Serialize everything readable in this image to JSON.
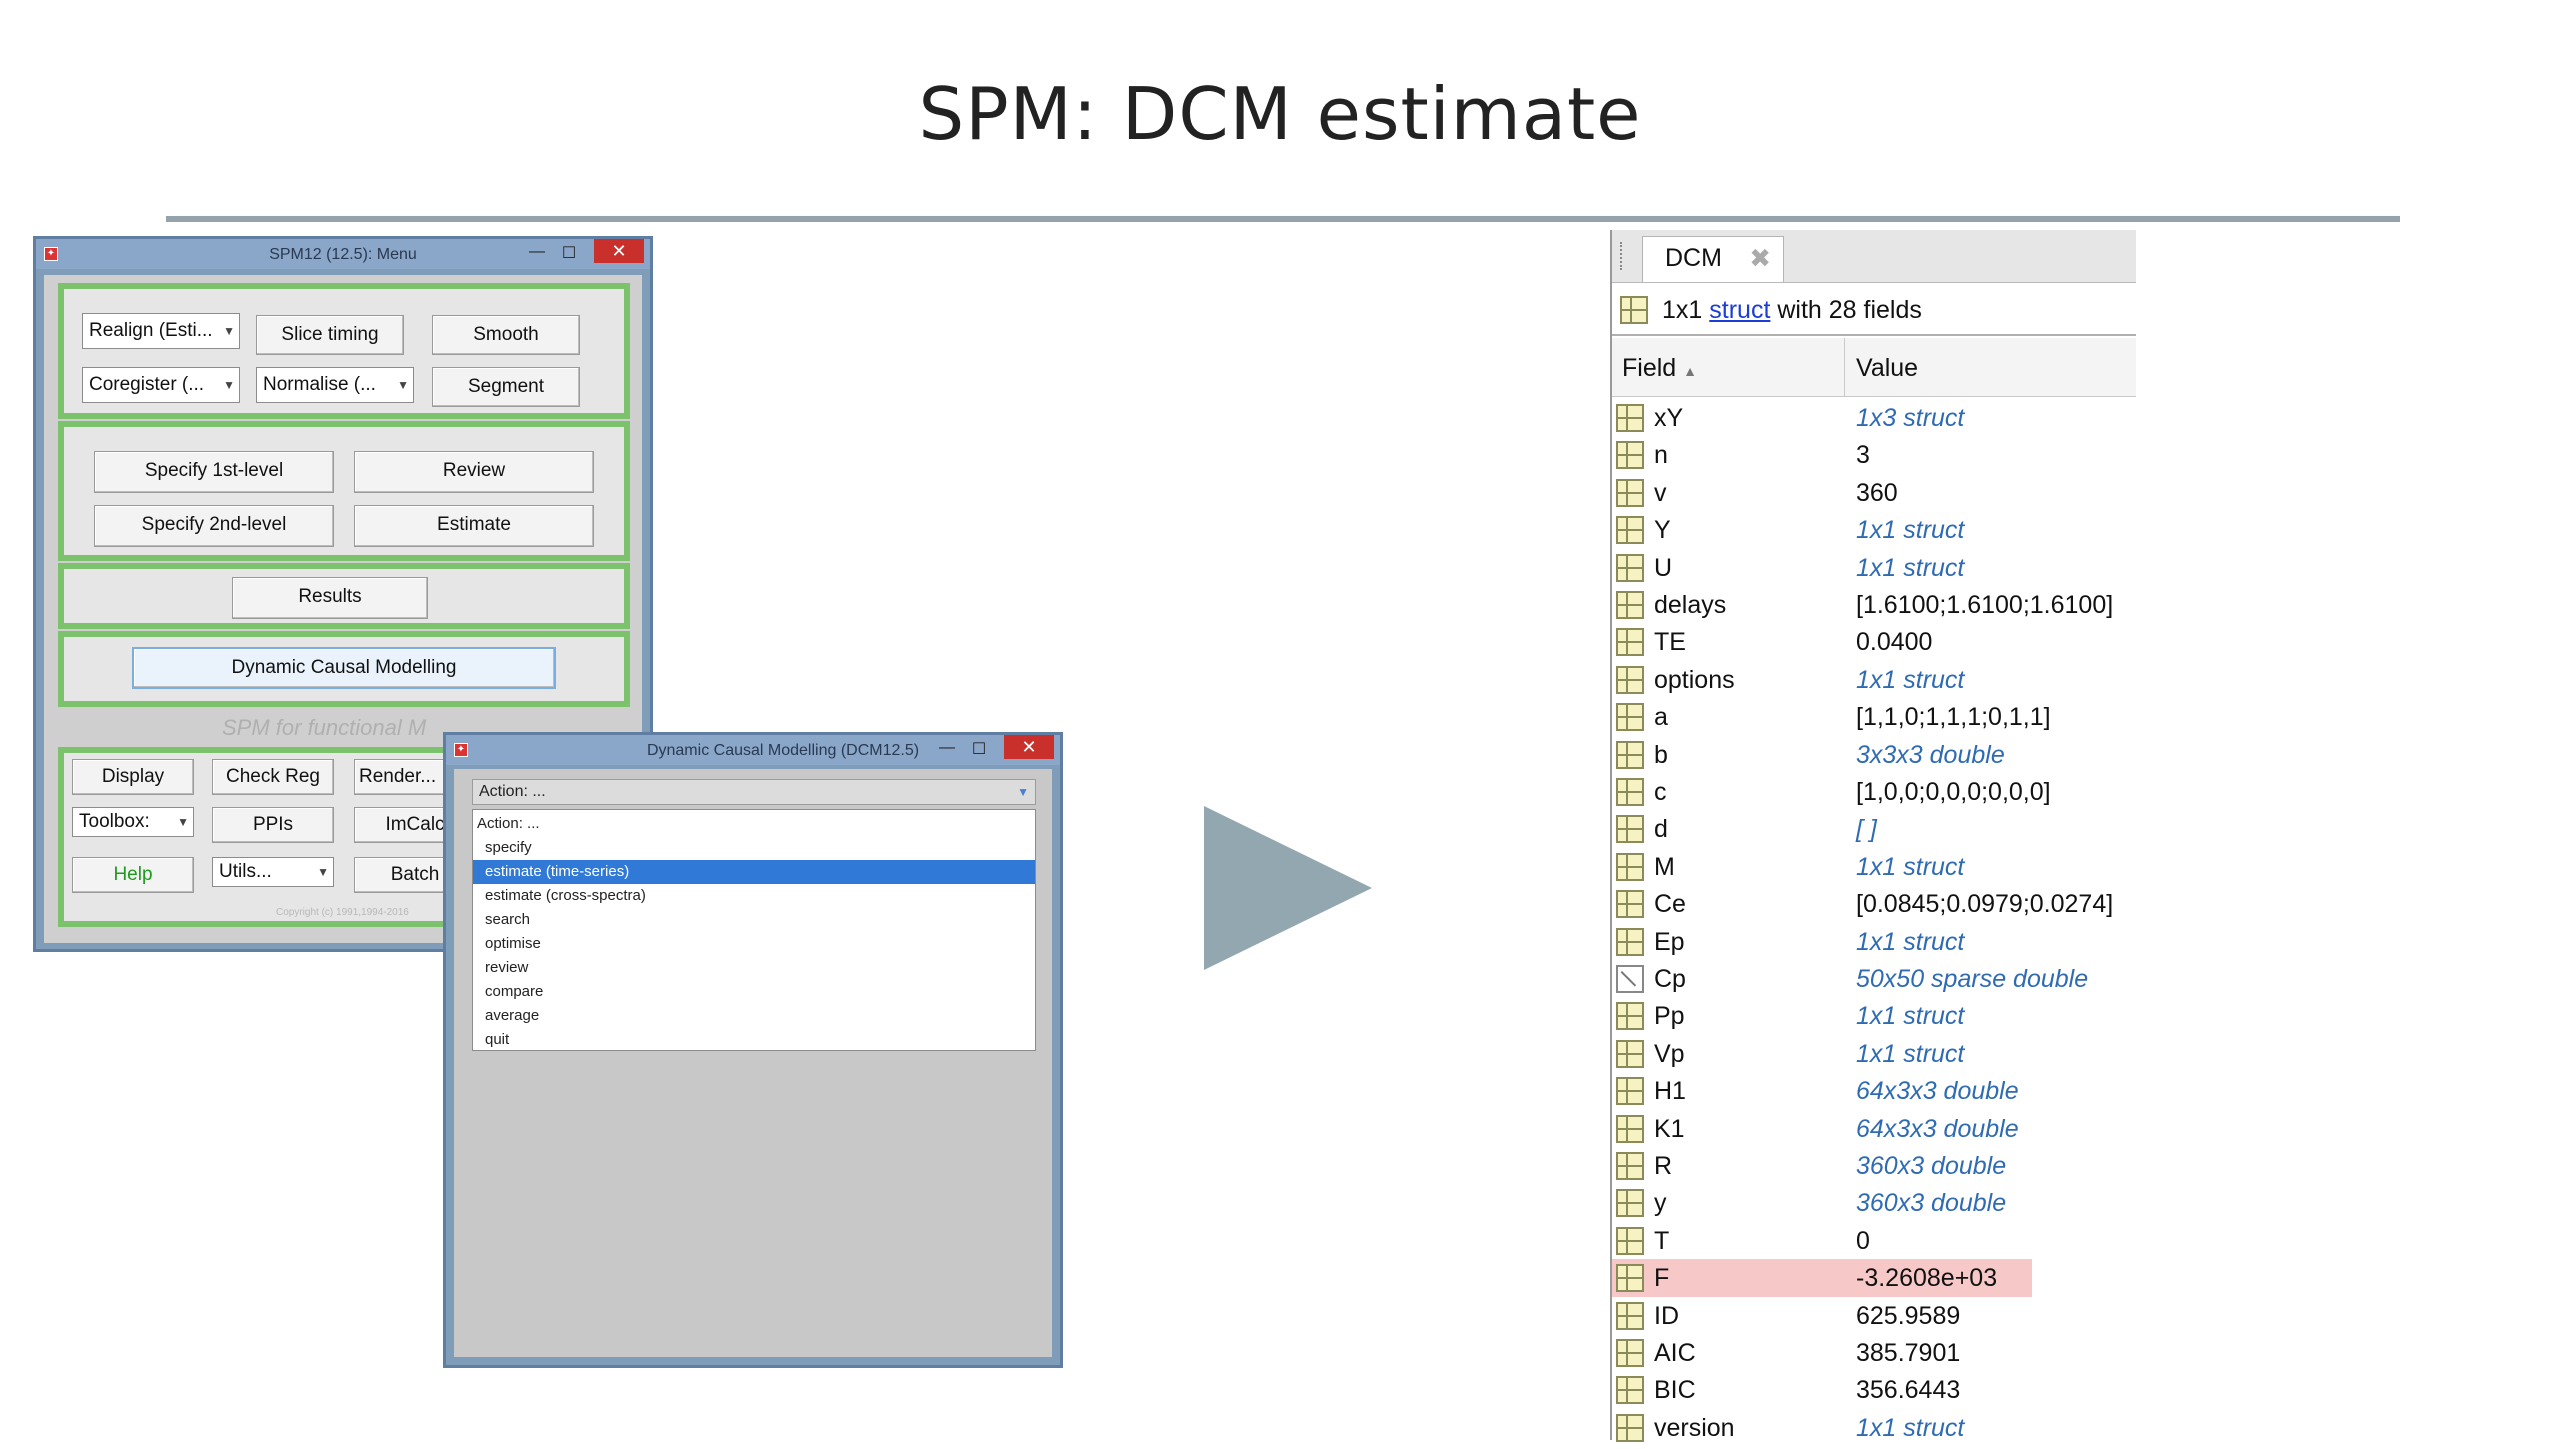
{
  "slide": {
    "title": "SPM: DCM estimate"
  },
  "spm_menu": {
    "window_title": "SPM12 (12.5): Menu",
    "preprocessing": {
      "realign": "Realign (Esti...",
      "coregister": "Coregister (...",
      "slice_timing": "Slice timing",
      "normalise": "Normalise (...",
      "smooth": "Smooth",
      "segment": "Segment"
    },
    "model": {
      "specify_1st": "Specify 1st-level",
      "review": "Review",
      "specify_2nd": "Specify 2nd-level",
      "estimate": "Estimate"
    },
    "results": "Results",
    "dcm": "Dynamic Causal Modelling",
    "footer_label": "SPM for functional M",
    "tools": {
      "display": "Display",
      "check_reg": "Check Reg",
      "render": "Render...",
      "toolbox": "Toolbox:",
      "ppis": "PPIs",
      "imcalc": "ImCalc",
      "help": "Help",
      "utils": "Utils...",
      "batch": "Batch"
    },
    "copyright": "Copyright (c) 1991,1994-2016"
  },
  "dcm_dialog": {
    "window_title": "Dynamic Causal Modelling (DCM12.5)",
    "action_placeholder": "Action: ...",
    "actions": [
      "Action: ...",
      "specify",
      "estimate (time-series)",
      "estimate (cross-spectra)",
      "search",
      "optimise",
      "review",
      "compare",
      "average",
      "quit"
    ],
    "selected_index": 2
  },
  "variable_panel": {
    "tab_label": "DCM",
    "summary_prefix": "1x1",
    "summary_link": "struct",
    "summary_suffix": "with 28 fields",
    "col_field": "Field",
    "col_value": "Value",
    "highlight_field": "F",
    "fields": [
      {
        "name": "xY",
        "value": "1x3 struct",
        "italic": true,
        "icon": "struct"
      },
      {
        "name": "n",
        "value": "3",
        "italic": false,
        "icon": "grid"
      },
      {
        "name": "v",
        "value": "360",
        "italic": false,
        "icon": "grid"
      },
      {
        "name": "Y",
        "value": "1x1 struct",
        "italic": true,
        "icon": "struct"
      },
      {
        "name": "U",
        "value": "1x1 struct",
        "italic": true,
        "icon": "struct"
      },
      {
        "name": "delays",
        "value": "[1.6100;1.6100;1.6100]",
        "italic": false,
        "icon": "grid"
      },
      {
        "name": "TE",
        "value": "0.0400",
        "italic": false,
        "icon": "grid"
      },
      {
        "name": "options",
        "value": "1x1 struct",
        "italic": true,
        "icon": "struct"
      },
      {
        "name": "a",
        "value": "[1,1,0;1,1,1;0,1,1]",
        "italic": false,
        "icon": "grid"
      },
      {
        "name": "b",
        "value": "3x3x3 double",
        "italic": true,
        "icon": "grid"
      },
      {
        "name": "c",
        "value": "[1,0,0;0,0,0;0,0,0]",
        "italic": false,
        "icon": "grid"
      },
      {
        "name": "d",
        "value": "[ ]",
        "italic": true,
        "icon": "grid"
      },
      {
        "name": "M",
        "value": "1x1 struct",
        "italic": true,
        "icon": "struct"
      },
      {
        "name": "Ce",
        "value": "[0.0845;0.0979;0.0274]",
        "italic": false,
        "icon": "grid"
      },
      {
        "name": "Ep",
        "value": "1x1 struct",
        "italic": true,
        "icon": "struct"
      },
      {
        "name": "Cp",
        "value": "50x50 sparse double",
        "italic": true,
        "icon": "sparse"
      },
      {
        "name": "Pp",
        "value": "1x1 struct",
        "italic": true,
        "icon": "struct"
      },
      {
        "name": "Vp",
        "value": "1x1 struct",
        "italic": true,
        "icon": "struct"
      },
      {
        "name": "H1",
        "value": "64x3x3 double",
        "italic": true,
        "icon": "grid"
      },
      {
        "name": "K1",
        "value": "64x3x3 double",
        "italic": true,
        "icon": "grid"
      },
      {
        "name": "R",
        "value": "360x3 double",
        "italic": true,
        "icon": "grid"
      },
      {
        "name": "y",
        "value": "360x3 double",
        "italic": true,
        "icon": "grid"
      },
      {
        "name": "T",
        "value": "0",
        "italic": false,
        "icon": "grid"
      },
      {
        "name": "F",
        "value": "-3.2608e+03",
        "italic": false,
        "icon": "grid"
      },
      {
        "name": "ID",
        "value": "625.9589",
        "italic": false,
        "icon": "grid"
      },
      {
        "name": "AIC",
        "value": "385.7901",
        "italic": false,
        "icon": "grid"
      },
      {
        "name": "BIC",
        "value": "356.6443",
        "italic": false,
        "icon": "grid"
      },
      {
        "name": "version",
        "value": "1x1 struct",
        "italic": true,
        "icon": "struct"
      }
    ]
  },
  "colors": {
    "accent_green": "#7cc16c",
    "arrow": "#93a7b0",
    "highlight_row": "#f6c8c8",
    "italic_value": "#2f6bb3",
    "selected_action": "#3079d6"
  }
}
